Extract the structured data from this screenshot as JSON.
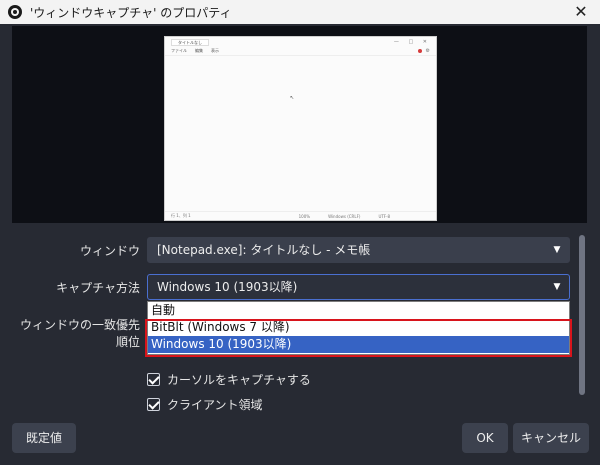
{
  "window": {
    "title": "'ウィンドウキャプチャ' のプロパティ",
    "close_glyph": "✕"
  },
  "preview": {
    "tab_label": "タイトルなし",
    "window_controls": "— □ ✕",
    "menu": [
      "ファイル",
      "編集",
      "表示"
    ],
    "status": [
      "行 1、列 1",
      "100%",
      "Windows (CRLF)",
      "UTF-8"
    ]
  },
  "form": {
    "window_label": "ウィンドウ",
    "window_value": "[Notepad.exe]: タイトルなし - メモ帳",
    "capture_method_label": "キャプチャ方法",
    "capture_method_value": "Windows 10 (1903以降)",
    "match_priority_label": "ウィンドウの一致優先順位",
    "capture_cursor_label": "カーソルをキャプチャする",
    "client_area_label": "クライアント領域"
  },
  "dropdown": {
    "options": [
      "自動",
      "BitBlt (Windows 7 以降)",
      "Windows 10 (1903以降)"
    ],
    "selected_index": 2
  },
  "buttons": {
    "defaults": "既定値",
    "ok": "OK",
    "cancel": "キャンセル"
  },
  "colors": {
    "background": "#272a33",
    "accent": "#3663c4",
    "highlight_border": "#d8141c"
  }
}
